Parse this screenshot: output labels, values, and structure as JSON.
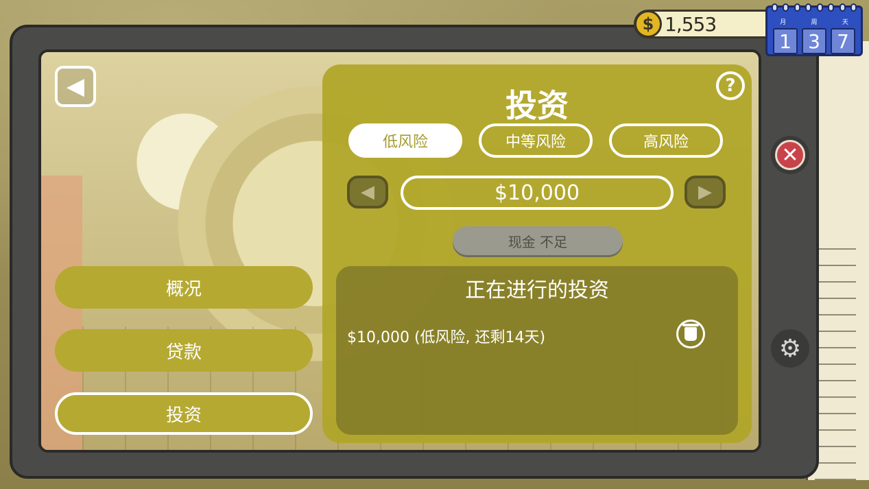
{
  "hud": {
    "currency_symbol": "$",
    "money": "1,553",
    "calendar": {
      "labels": [
        "月",
        "周",
        "天"
      ],
      "digits": [
        "1",
        "3",
        "7"
      ]
    }
  },
  "sidebar": {
    "items": [
      {
        "label": "概况"
      },
      {
        "label": "贷款"
      },
      {
        "label": "投资"
      }
    ],
    "active_index": 2
  },
  "panel": {
    "title": "投资",
    "help_symbol": "?",
    "tabs": [
      {
        "label": "低风险"
      },
      {
        "label": "中等风险"
      },
      {
        "label": "高风险"
      }
    ],
    "active_tab": 0,
    "amount": "$10,000",
    "insufficient_label": "现金 不足",
    "ongoing": {
      "title": "正在进行的投资",
      "items": [
        {
          "text": "$10,000 (低风险, 还剩14天)"
        }
      ]
    }
  },
  "icons": {
    "back": "back-arrow-icon",
    "close": "close-icon",
    "settings": "gear-icon",
    "trash": "trash-icon",
    "help": "help-icon"
  },
  "colors": {
    "panel": "#b0a628",
    "close": "#c9434a",
    "calendar": "#2d4fc0",
    "coin": "#e2b523"
  }
}
